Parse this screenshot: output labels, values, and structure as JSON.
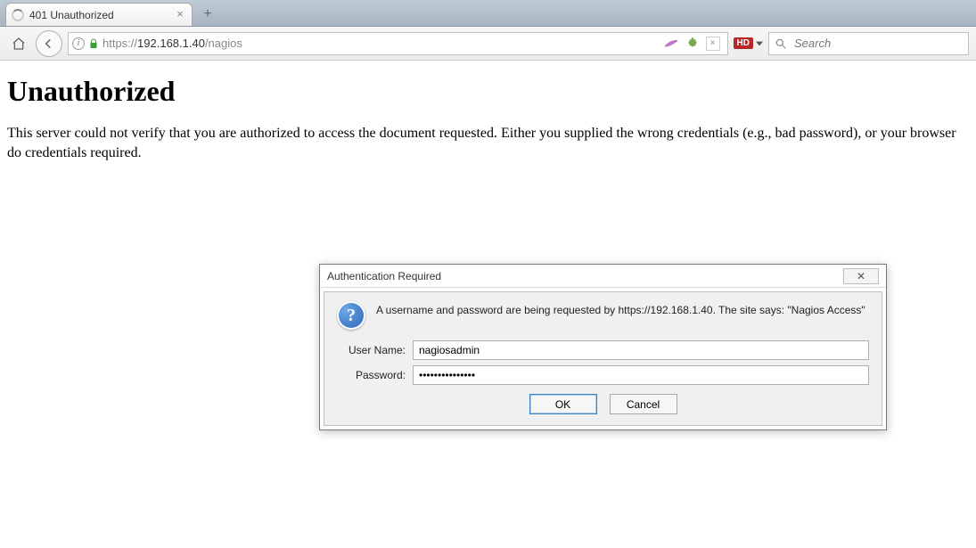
{
  "tab": {
    "title": "401 Unauthorized"
  },
  "url": {
    "scheme": "https://",
    "host": "192.168.1.40",
    "path": "/nagios"
  },
  "search": {
    "placeholder": "Search"
  },
  "hd_badge": "HD",
  "page": {
    "heading": "Unauthorized",
    "body": "This server could not verify that you are authorized to access the document requested. Either you supplied the wrong credentials (e.g., bad password), or your browser do credentials required."
  },
  "dialog": {
    "title": "Authentication Required",
    "message": "A username and password are being requested by https://192.168.1.40. The site says: \"Nagios Access\"",
    "username_label": "User Name:",
    "password_label": "Password:",
    "username_value": "nagiosadmin",
    "password_value": "•••••••••••••••",
    "ok_label": "OK",
    "cancel_label": "Cancel",
    "close_glyph": "✕"
  }
}
